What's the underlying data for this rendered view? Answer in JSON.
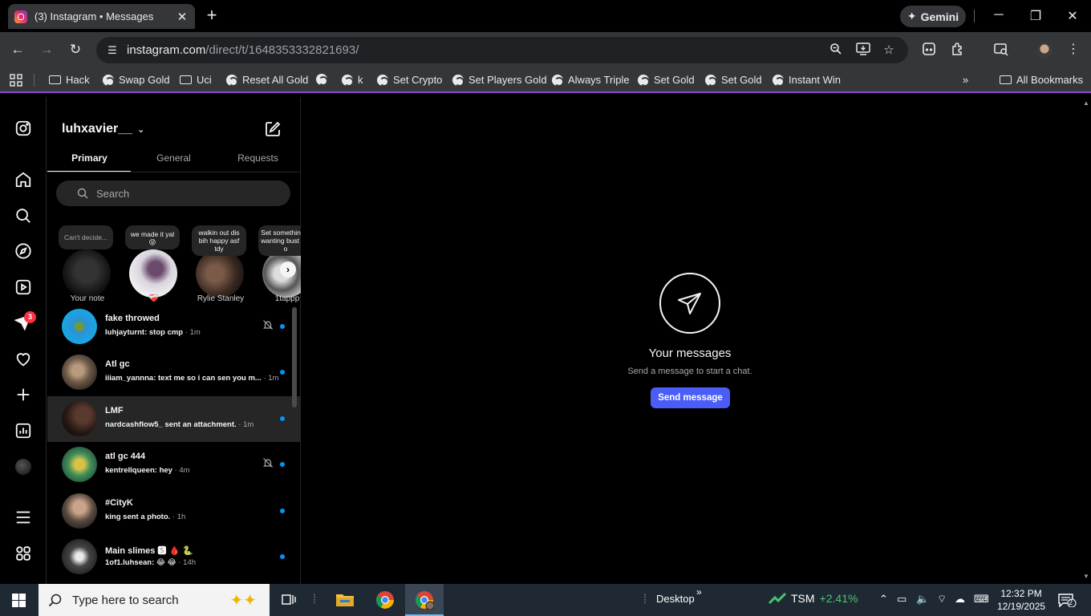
{
  "browser": {
    "tab_title": "(3) Instagram • Messages",
    "gemini_label": "Gemini",
    "url_host": "instagram.com",
    "url_path": "/direct/t/1648353332821693/"
  },
  "bookmarks": {
    "items": [
      {
        "icon": "folder",
        "label": "Hack"
      },
      {
        "icon": "globe",
        "label": "Swap Gold"
      },
      {
        "icon": "folder",
        "label": "Uci"
      },
      {
        "icon": "globe",
        "label": "Reset All Gold"
      },
      {
        "icon": "globe",
        "label": ""
      },
      {
        "icon": "globe",
        "label": "k"
      },
      {
        "icon": "globe",
        "label": "Set Crypto"
      },
      {
        "icon": "globe",
        "label": "Set Players Gold"
      },
      {
        "icon": "globe",
        "label": "Always Triple"
      },
      {
        "icon": "globe",
        "label": "Set Gold"
      },
      {
        "icon": "globe",
        "label": "Set Gold"
      },
      {
        "icon": "globe",
        "label": "Instant Win"
      }
    ],
    "overflow": "»",
    "all_bookmarks": "All Bookmarks"
  },
  "rail": {
    "notification_count": "3"
  },
  "inbox": {
    "username": "luhxavier__",
    "tabs": [
      "Primary",
      "General",
      "Requests"
    ],
    "search_placeholder": "Search",
    "notes": [
      {
        "bubble": "Can't decide...",
        "name": "Your note"
      },
      {
        "bubble": "we made it yal 😝",
        "name": "❤️‍🩹"
      },
      {
        "bubble": "walkin out dis bih happy asf tdy",
        "name": "Rylie Stanley"
      },
      {
        "bubble": "Set somethin be wanting bust my o",
        "name": "1tappp"
      }
    ],
    "threads": [
      {
        "name": "fake throwed",
        "preview": "luhjayturnt: stop cmp",
        "time": " · 1m",
        "muted": true
      },
      {
        "name": "Atl gc",
        "preview": "iiiam_yannna: text me so i can sen you m...",
        "time": " · 1m",
        "muted": false
      },
      {
        "name": "LMF",
        "preview": "nardcashflow5_ sent an attachment.",
        "time": " · 1m",
        "muted": false
      },
      {
        "name": "atl gc 444",
        "preview": "kentrellqueen: hey",
        "time": " · 4m",
        "muted": true
      },
      {
        "name": "#CityK",
        "preview": "king sent a photo.",
        "time": " · 1h",
        "muted": false
      },
      {
        "name": "Main slimes 🆂 🩸 🐍",
        "preview": "1of1.luhsean: 😂 😂",
        "time": " · 14h",
        "muted": false
      }
    ]
  },
  "main": {
    "title": "Your messages",
    "subtitle": "Send a message to start a chat.",
    "button": "Send message"
  },
  "taskbar": {
    "search_placeholder": "Type here to search",
    "desktop_label": "Desktop",
    "stock_symbol": "TSM",
    "stock_change": "+2.41%",
    "time": "12:32 PM",
    "date": "12/19/2025",
    "notification_count": "2"
  },
  "colors": {
    "accent_blue": "#4a5df9",
    "unread_dot": "#0095f6",
    "badge_red": "#ff3040",
    "bookmark_bar_border": "#8f45d6",
    "stock_green": "#4cc271"
  }
}
